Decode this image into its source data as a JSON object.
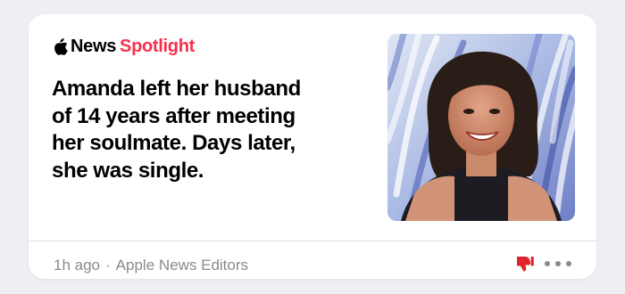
{
  "card": {
    "brand": {
      "logo_icon": "apple-logo-icon",
      "news": "News",
      "spotlight": "Spotlight",
      "spotlight_color": "#f5304f"
    },
    "headline_lines": [
      "Amanda left her husband",
      "of 14 years after meeting",
      "her soulmate. Days later,",
      "she was single."
    ],
    "thumbnail": "photo of a smiling woman with dark curly hair",
    "footer": {
      "time": "1h ago",
      "separator": "·",
      "source": "Apple News Editors"
    },
    "actions": {
      "dislike_icon": "thumbs-down-icon",
      "dislike_color": "#e0242c",
      "more_icon": "more-ellipsis-icon"
    }
  }
}
